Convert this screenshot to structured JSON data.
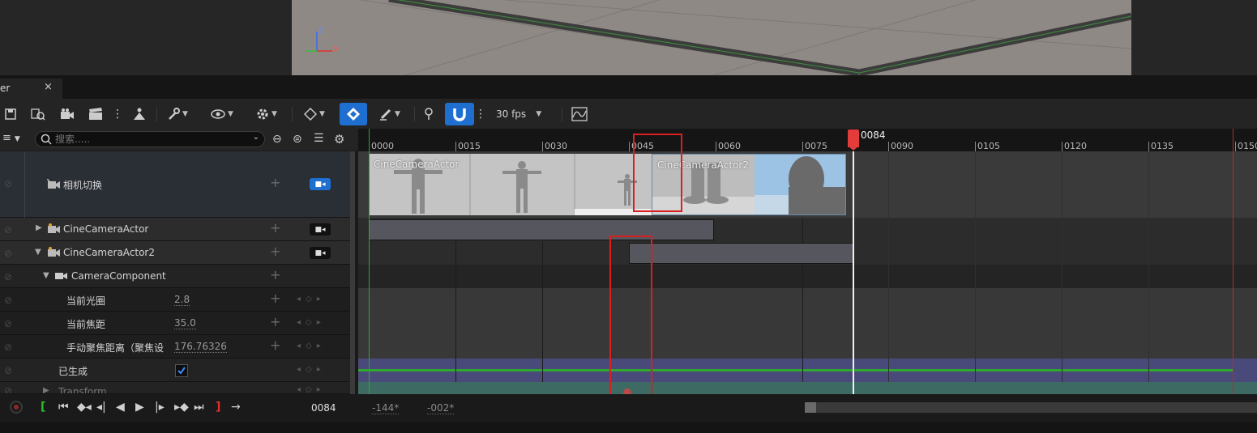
{
  "colors": {
    "accent": "#1f6fd1",
    "playhead": "#e43b3b",
    "highlight_box": "#d82020",
    "spawn_track": "#4a4a7a",
    "green_line": "#2fa82f",
    "transform_track": "#3d6b63"
  },
  "viewport": {
    "axis_z": "Z",
    "axis_x": "X"
  },
  "tab": {
    "title": "er",
    "close": "×"
  },
  "toolbar": {
    "fps_label": "30 fps",
    "icons": [
      "save-icon",
      "find-icon",
      "camera-icon",
      "clapper-icon",
      "more-icon",
      "actors-icon",
      "wrench-icon",
      "eye-icon",
      "gear-icon",
      "key-icon",
      "auto-key-icon",
      "pencil-icon",
      "marker-icon",
      "snap-icon",
      "curve-editor-icon"
    ]
  },
  "search": {
    "placeholder": "搜索....."
  },
  "tracks": [
    {
      "label": "相机切换",
      "icon": "camera-cut-icon"
    },
    {
      "label": "CineCameraActor",
      "icon": "cine-camera-icon"
    },
    {
      "label": "CineCameraActor2",
      "icon": "cine-camera-icon"
    },
    {
      "label": "CameraComponent",
      "icon": "video-camera-icon"
    },
    {
      "label": "当前光圈",
      "value": "2.8"
    },
    {
      "label": "当前焦距",
      "value": "35.0"
    },
    {
      "label": "手动聚焦距离（聚焦设",
      "value": "176.76326"
    },
    {
      "label": "已生成",
      "checked": true
    },
    {
      "label": "Transform"
    }
  ],
  "timeline": {
    "ruler_labels": [
      "0000",
      "0015",
      "0030",
      "0045",
      "0060",
      "0075",
      "0090",
      "0105",
      "0120",
      "0135",
      "0150"
    ],
    "playhead_label": "0084",
    "thumbnails": [
      "CineCameraActor",
      "CineCameraActor2"
    ]
  },
  "transport": {
    "current_frame": "0084",
    "start_range": "-144*",
    "end_range": "-002*"
  }
}
